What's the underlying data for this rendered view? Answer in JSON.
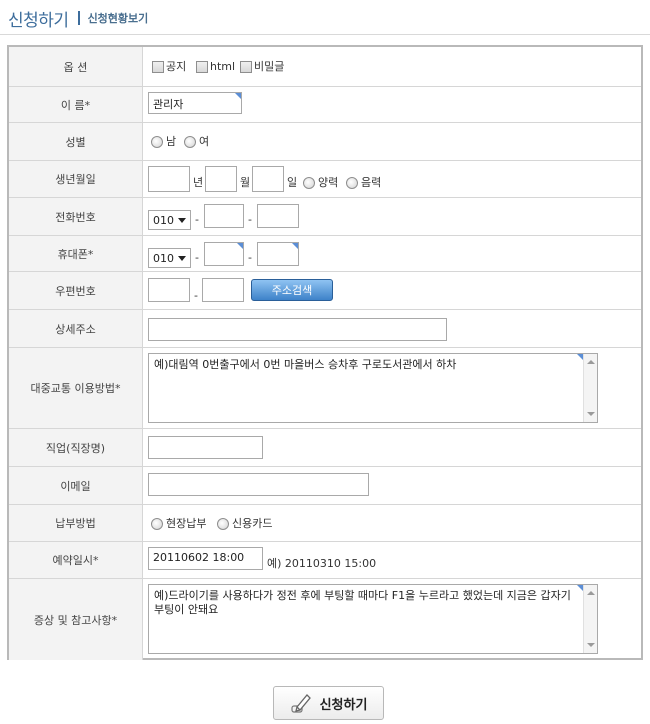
{
  "header": {
    "title": "신청하기",
    "subtitle": "신청현황보기"
  },
  "rows": {
    "options": {
      "label": "옵 션",
      "items": [
        "공지",
        "html",
        "비밀글"
      ]
    },
    "name": {
      "label": "이 름*",
      "value": "관리자"
    },
    "gender": {
      "label": "성별",
      "male": "남",
      "female": "여"
    },
    "birth": {
      "label": "생년월일",
      "year_unit": "년",
      "month_unit": "월",
      "day_unit": "일",
      "solar": "양력",
      "lunar": "음력"
    },
    "phone": {
      "label": "전화번호",
      "prefix": "010",
      "dash": "-"
    },
    "mobile": {
      "label": "휴대폰*",
      "prefix": "010",
      "dash": "-"
    },
    "zip": {
      "label": "우편번호",
      "dash": "-",
      "search_button": "주소검색"
    },
    "address": {
      "label": "상세주소"
    },
    "transit": {
      "label": "대중교통 이용방법*",
      "value": "예)대림역 0번출구에서 0번 마을버스 승차후 구로도서관에서 하차"
    },
    "job": {
      "label": "직업(직장명)"
    },
    "email": {
      "label": "이메일"
    },
    "payment": {
      "label": "납부방법",
      "onsite": "현장납부",
      "card": "신용카드"
    },
    "reservation": {
      "label": "예약일시*",
      "value": "20110602 18:00",
      "example": "예) 20110310 15:00"
    },
    "symptoms": {
      "label": "증상 및 참고사항*",
      "value": "예)드라이기를 사용하다가 정전 후에 부팅할 때마다 F1을 누르라고 했었는데 지금은 갑자기 부팅이 안돼요"
    }
  },
  "submit_label": "신청하기",
  "colors": {
    "accent": "#3d6d9c",
    "label_bg": "#f3f3f3",
    "button_blue": "#3e82c9"
  }
}
